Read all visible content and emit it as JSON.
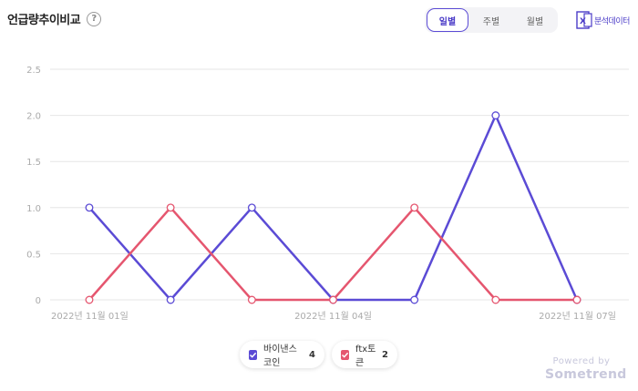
{
  "header": {
    "title": "언급량추이비교",
    "help_icon": "?"
  },
  "tabs": [
    {
      "label": "일별",
      "active": true
    },
    {
      "label": "주별",
      "active": false
    },
    {
      "label": "월별",
      "active": false
    }
  ],
  "excel": {
    "icon": "excel-icon",
    "label": "분석데이터"
  },
  "chart_data": {
    "type": "line",
    "x": [
      "2022년 11월 01일",
      "2022년 11월 02일",
      "2022년 11월 03일",
      "2022년 11월 04일",
      "2022년 11월 05일",
      "2022년 11월 06일",
      "2022년 11월 07일"
    ],
    "x_tick_labels": [
      "2022년 11월 01일",
      "2022년 11월 04일",
      "2022년 11월 07일"
    ],
    "y_tick_labels": [
      "0",
      "0.5",
      "1.0",
      "1.5",
      "2.0",
      "2.5"
    ],
    "ylim": [
      0,
      2.5
    ],
    "grid": true,
    "legend_position": "bottom-center",
    "series": [
      {
        "name": "바이낸스코인",
        "total": "4",
        "color": "#5b4bd5",
        "values": [
          1,
          0,
          1,
          0,
          0,
          2,
          0
        ]
      },
      {
        "name": "ftx토큰",
        "total": "2",
        "color": "#e5566f",
        "values": [
          0,
          1,
          0,
          0,
          1,
          0,
          0
        ]
      }
    ]
  },
  "watermark": {
    "line1": "Powered by",
    "line2": "Sometrend"
  }
}
